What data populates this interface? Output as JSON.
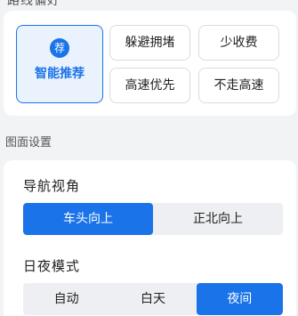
{
  "header": {
    "clipped_title": "路线偏好"
  },
  "route": {
    "recommended": {
      "badge": "荐",
      "label": "智能推荐"
    },
    "options": [
      "躲避拥堵",
      "少收费",
      "高速优先",
      "不走高速"
    ],
    "selected": "智能推荐"
  },
  "display": {
    "section_label": "图面设置",
    "nav_view": {
      "title": "导航视角",
      "options": [
        "车头向上",
        "正北向上"
      ],
      "selected": "车头向上"
    },
    "day_night": {
      "title": "日夜模式",
      "options": [
        "自动",
        "白天",
        "夜间"
      ],
      "selected": "夜间"
    }
  },
  "colors": {
    "accent": "#1a73e8",
    "background": "#f2f3f5",
    "card": "#ffffff"
  }
}
